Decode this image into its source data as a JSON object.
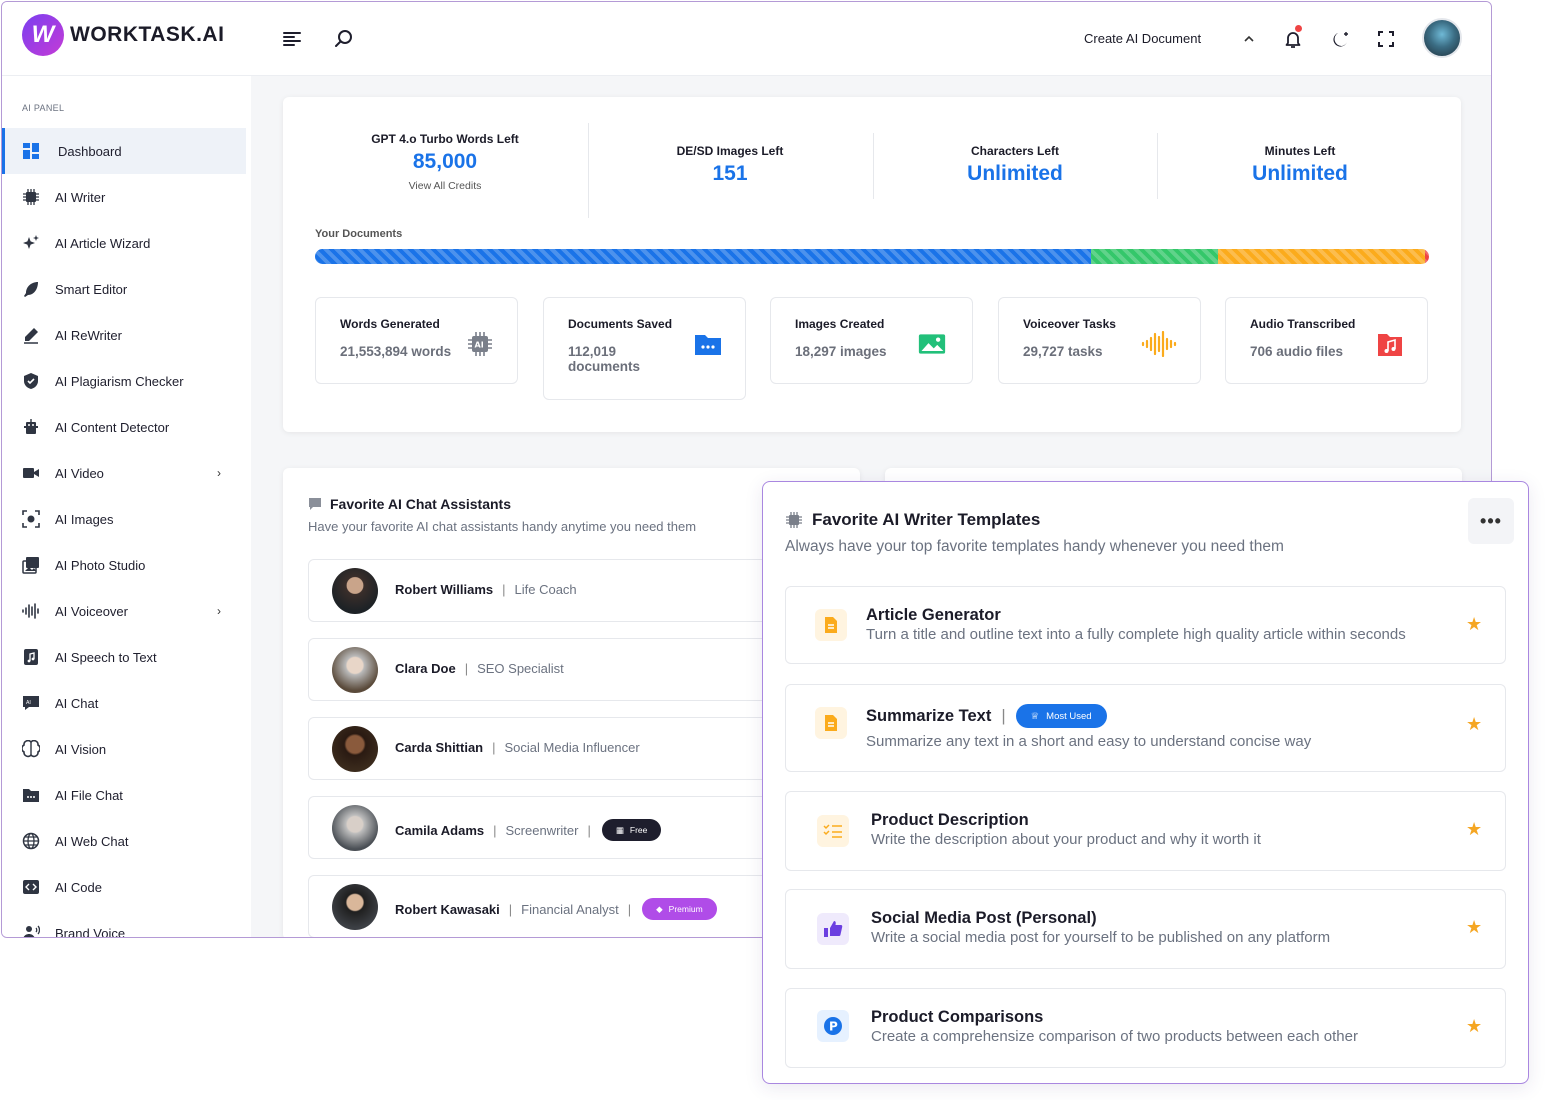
{
  "brand": {
    "logo_letter": "W",
    "name": "WORKTASK.AI"
  },
  "topbar": {
    "create_doc": "Create AI Document"
  },
  "sidebar": {
    "section": "AI PANEL",
    "items": [
      {
        "label": "Dashboard",
        "icon": "dashboard-icon"
      },
      {
        "label": "AI Writer",
        "icon": "chip-icon"
      },
      {
        "label": "AI Article Wizard",
        "icon": "sparkles-icon"
      },
      {
        "label": "Smart Editor",
        "icon": "feather-icon"
      },
      {
        "label": "AI ReWriter",
        "icon": "pen-icon"
      },
      {
        "label": "AI Plagiarism Checker",
        "icon": "shield-icon"
      },
      {
        "label": "AI Content Detector",
        "icon": "robot-icon"
      },
      {
        "label": "AI Video",
        "icon": "video-icon"
      },
      {
        "label": "AI Images",
        "icon": "image-scan-icon"
      },
      {
        "label": "AI Photo Studio",
        "icon": "photos-icon"
      },
      {
        "label": "AI Voiceover",
        "icon": "waveform-icon"
      },
      {
        "label": "AI Speech to Text",
        "icon": "music-file-icon"
      },
      {
        "label": "AI Chat",
        "icon": "chat-icon"
      },
      {
        "label": "AI Vision",
        "icon": "brain-icon"
      },
      {
        "label": "AI File Chat",
        "icon": "folder-icon"
      },
      {
        "label": "AI Web Chat",
        "icon": "globe-icon"
      },
      {
        "label": "AI Code",
        "icon": "code-icon"
      },
      {
        "label": "Brand Voice",
        "icon": "voice-icon"
      }
    ]
  },
  "credits": [
    {
      "label": "GPT 4.o Turbo Words Left",
      "value": "85,000",
      "sub": "View All Credits"
    },
    {
      "label": "DE/SD Images Left",
      "value": "151"
    },
    {
      "label": "Characters Left",
      "value": "Unlimited"
    },
    {
      "label": "Minutes Left",
      "value": "Unlimited"
    }
  ],
  "documents": {
    "label": "Your Documents",
    "usage_fractions": [
      0.697,
      0.114,
      0.185,
      0.004
    ],
    "colors": [
      "#1a73e8",
      "#34c76a",
      "#fbab1c",
      "#ef4444"
    ]
  },
  "stats": [
    {
      "label": "Words Generated",
      "value": "21,553,894 words",
      "icon": "ai-chip-icon",
      "color": "#7a7f8a"
    },
    {
      "label": "Documents Saved",
      "value": "112,019 documents",
      "icon": "folder-icon",
      "color": "#1a73e8"
    },
    {
      "label": "Images Created",
      "value": "18,297 images",
      "icon": "image-icon",
      "color": "#22c07a"
    },
    {
      "label": "Voiceover Tasks",
      "value": "29,727 tasks",
      "icon": "waveform-icon",
      "color": "#fbab1c"
    },
    {
      "label": "Audio Transcribed",
      "value": "706 audio files",
      "icon": "music-file-icon",
      "color": "#ef4444"
    }
  ],
  "chat_assistants": {
    "title": "Favorite AI Chat Assistants",
    "subtitle": "Have your favorite AI chat assistants handy anytime you need them",
    "items": [
      {
        "name": "Robert Williams",
        "role": "Life Coach"
      },
      {
        "name": "Clara Doe",
        "role": "SEO Specialist"
      },
      {
        "name": "Carda Shittian",
        "role": "Social Media Influencer"
      },
      {
        "name": "Camila Adams",
        "role": "Screenwriter",
        "badge": "Free"
      },
      {
        "name": "Robert Kawasaki",
        "role": "Financial Analyst",
        "badge": "Premium"
      }
    ]
  },
  "templates": {
    "title": "Favorite AI Writer Templates",
    "subtitle": "Always have your top favorite templates handy whenever you need them",
    "more": "•••",
    "items": [
      {
        "title": "Article Generator",
        "desc": "Turn a title and outline text into a fully complete high quality article within seconds",
        "icon": "document-icon"
      },
      {
        "title": "Summarize Text",
        "desc": "Summarize any text in a short and easy to understand concise way",
        "icon": "document-icon",
        "badge": "Most Used"
      },
      {
        "title": "Product Description",
        "desc": "Write the description about your product and why it worth it",
        "icon": "checklist-icon"
      },
      {
        "title": "Social Media Post (Personal)",
        "desc": "Write a social media post for yourself to be published on any platform",
        "icon": "thumbs-up-icon"
      },
      {
        "title": "Product Comparisons",
        "desc": "Create a comprehensize comparison of two products between each other",
        "icon": "p-badge-icon"
      }
    ]
  }
}
